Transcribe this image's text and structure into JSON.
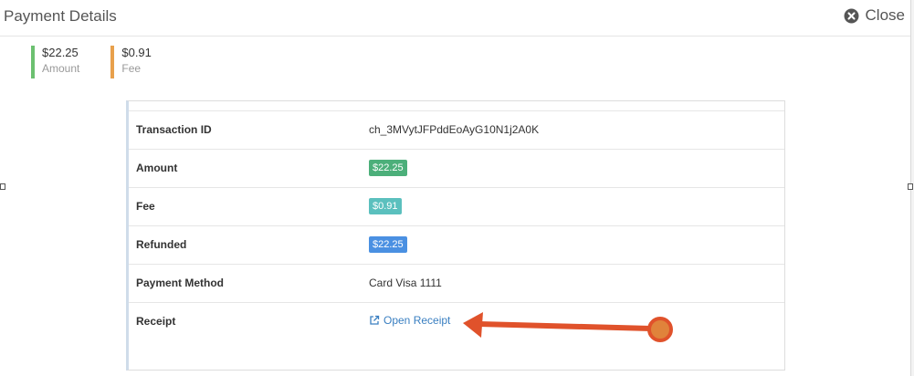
{
  "header": {
    "title": "Payment Details",
    "close_label": "Close"
  },
  "summary": [
    {
      "value": "$22.25",
      "label": "Amount",
      "color": "#6cc070"
    },
    {
      "value": "$0.91",
      "label": "Fee",
      "color": "#e8a04c"
    }
  ],
  "details": {
    "transaction_id": {
      "label": "Transaction ID",
      "value": "ch_3MVytJFPddEoAyG10N1j2A0K"
    },
    "amount": {
      "label": "Amount",
      "value": "$22.25",
      "color": "#4caf7a"
    },
    "fee": {
      "label": "Fee",
      "value": "$0.91",
      "color": "#5bc0be"
    },
    "refunded": {
      "label": "Refunded",
      "value": "$22.25",
      "color": "#4a90e2"
    },
    "payment_method": {
      "label": "Payment Method",
      "value": "Card Visa 1111"
    },
    "receipt": {
      "label": "Receipt",
      "link_text": "Open Receipt",
      "link_icon": "external-link-icon"
    }
  },
  "annotation": {
    "color": "#e0522b",
    "points_to": "receipt-link"
  }
}
